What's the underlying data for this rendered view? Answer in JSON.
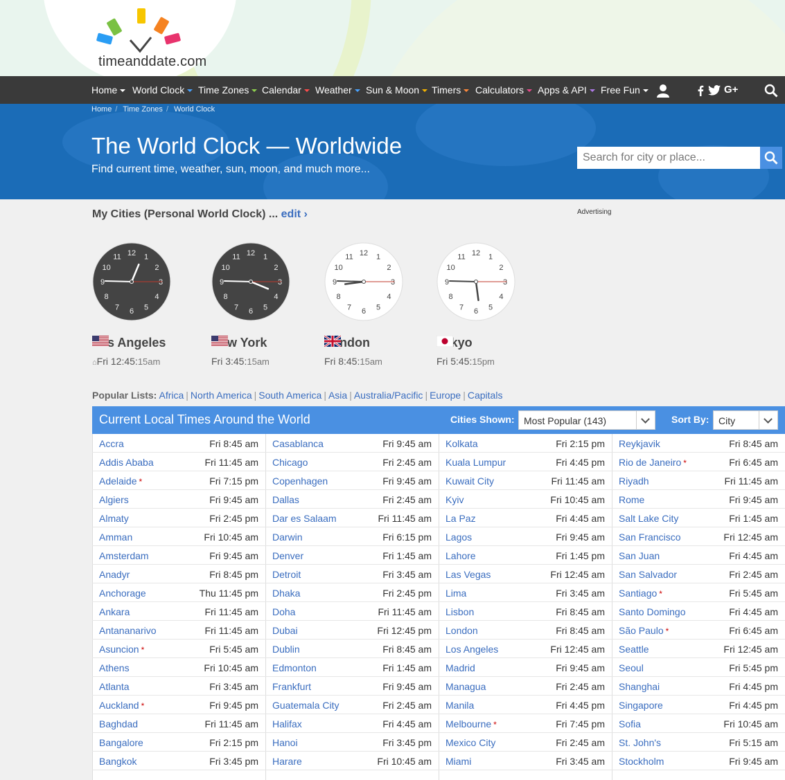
{
  "logo": {
    "text": "timeanddate.com"
  },
  "colors": {
    "nav_bg": "#3a3a3a",
    "banner_bg": "#1b6cb7",
    "table_header": "#4a90e2",
    "link": "#3a6dbf"
  },
  "nav": {
    "items": [
      {
        "label": "Home",
        "caret": "#ffffff"
      },
      {
        "label": "World Clock",
        "caret": "#4aa3ff"
      },
      {
        "label": "Time Zones",
        "caret": "#8fd14f"
      },
      {
        "label": "Calendar",
        "caret": "#ff4d4d"
      },
      {
        "label": "Weather",
        "caret": "#4aa3ff"
      },
      {
        "label": "Sun & Moon",
        "caret": "#f5b400"
      },
      {
        "label": "Timers",
        "caret": "#ff8a3d"
      },
      {
        "label": "Calculators",
        "caret": "#e84a8a"
      },
      {
        "label": "Apps & API",
        "caret": "#b07be8"
      },
      {
        "label": "Free Fun",
        "caret": "#ffffff"
      }
    ],
    "icons": [
      "user-icon",
      "facebook-icon",
      "twitter-icon",
      "google-plus-icon",
      "search-icon"
    ]
  },
  "breadcrumb": [
    "Home",
    "Time Zones",
    "World Clock"
  ],
  "header": {
    "title": "The World Clock — Worldwide",
    "subtitle": "Find current time, weather, sun, moon, and much more...",
    "search_placeholder": "Search for city or place..."
  },
  "my_cities": {
    "title": "My Cities (Personal World Clock) ...",
    "edit": "edit ›",
    "advertising": "Advertising",
    "clocks": [
      {
        "city": "Los Angeles",
        "day": "Fri",
        "hm": "12:45:",
        "sec": "15",
        "ampm": "am",
        "home": true,
        "dark": true,
        "flag": "us",
        "hour": 0,
        "minute": 45,
        "second": 15
      },
      {
        "city": "New York",
        "day": "Fri",
        "hm": "3:45:",
        "sec": "15",
        "ampm": "am",
        "home": false,
        "dark": true,
        "flag": "us",
        "hour": 3,
        "minute": 45,
        "second": 15
      },
      {
        "city": "London",
        "day": "Fri",
        "hm": "8:45:",
        "sec": "15",
        "ampm": "am",
        "home": false,
        "dark": false,
        "flag": "uk",
        "hour": 8,
        "minute": 45,
        "second": 15
      },
      {
        "city": "Tokyo",
        "day": "Fri",
        "hm": "5:45:",
        "sec": "15",
        "ampm": "pm",
        "home": false,
        "dark": false,
        "flag": "jp",
        "hour": 17,
        "minute": 45,
        "second": 15
      }
    ]
  },
  "popular_lists": {
    "label": "Popular Lists:",
    "links": [
      "Africa",
      "North America",
      "South America",
      "Asia",
      "Australia/Pacific",
      "Europe",
      "Capitals"
    ]
  },
  "table": {
    "title": "Current Local Times Around the World",
    "cities_shown_label": "Cities Shown:",
    "cities_shown_value": "Most Popular (143)",
    "sort_by_label": "Sort By:",
    "sort_by_value": "City",
    "columns": [
      [
        {
          "city": "Accra",
          "time": "Fri 8:45 am"
        },
        {
          "city": "Addis Ababa",
          "time": "Fri 11:45 am"
        },
        {
          "city": "Adelaide",
          "time": "Fri 7:15 pm",
          "dst": true
        },
        {
          "city": "Algiers",
          "time": "Fri 9:45 am"
        },
        {
          "city": "Almaty",
          "time": "Fri 2:45 pm"
        },
        {
          "city": "Amman",
          "time": "Fri 10:45 am"
        },
        {
          "city": "Amsterdam",
          "time": "Fri 9:45 am"
        },
        {
          "city": "Anadyr",
          "time": "Fri 8:45 pm"
        },
        {
          "city": "Anchorage",
          "time": "Thu 11:45 pm"
        },
        {
          "city": "Ankara",
          "time": "Fri 11:45 am"
        },
        {
          "city": "Antananarivo",
          "time": "Fri 11:45 am"
        },
        {
          "city": "Asuncion",
          "time": "Fri 5:45 am",
          "dst": true
        },
        {
          "city": "Athens",
          "time": "Fri 10:45 am"
        },
        {
          "city": "Atlanta",
          "time": "Fri 3:45 am"
        },
        {
          "city": "Auckland",
          "time": "Fri 9:45 pm",
          "dst": true
        },
        {
          "city": "Baghdad",
          "time": "Fri 11:45 am"
        },
        {
          "city": "Bangalore",
          "time": "Fri 2:15 pm"
        },
        {
          "city": "Bangkok",
          "time": "Fri 3:45 pm"
        }
      ],
      [
        {
          "city": "Casablanca",
          "time": "Fri 9:45 am"
        },
        {
          "city": "Chicago",
          "time": "Fri 2:45 am"
        },
        {
          "city": "Copenhagen",
          "time": "Fri 9:45 am"
        },
        {
          "city": "Dallas",
          "time": "Fri 2:45 am"
        },
        {
          "city": "Dar es Salaam",
          "time": "Fri 11:45 am"
        },
        {
          "city": "Darwin",
          "time": "Fri 6:15 pm"
        },
        {
          "city": "Denver",
          "time": "Fri 1:45 am"
        },
        {
          "city": "Detroit",
          "time": "Fri 3:45 am"
        },
        {
          "city": "Dhaka",
          "time": "Fri 2:45 pm"
        },
        {
          "city": "Doha",
          "time": "Fri 11:45 am"
        },
        {
          "city": "Dubai",
          "time": "Fri 12:45 pm"
        },
        {
          "city": "Dublin",
          "time": "Fri 8:45 am"
        },
        {
          "city": "Edmonton",
          "time": "Fri 1:45 am"
        },
        {
          "city": "Frankfurt",
          "time": "Fri 9:45 am"
        },
        {
          "city": "Guatemala City",
          "time": "Fri 2:45 am"
        },
        {
          "city": "Halifax",
          "time": "Fri 4:45 am"
        },
        {
          "city": "Hanoi",
          "time": "Fri 3:45 pm"
        },
        {
          "city": "Harare",
          "time": "Fri 10:45 am"
        }
      ],
      [
        {
          "city": "Kolkata",
          "time": "Fri 2:15 pm"
        },
        {
          "city": "Kuala Lumpur",
          "time": "Fri 4:45 pm"
        },
        {
          "city": "Kuwait City",
          "time": "Fri 11:45 am"
        },
        {
          "city": "Kyiv",
          "time": "Fri 10:45 am"
        },
        {
          "city": "La Paz",
          "time": "Fri 4:45 am"
        },
        {
          "city": "Lagos",
          "time": "Fri 9:45 am"
        },
        {
          "city": "Lahore",
          "time": "Fri 1:45 pm"
        },
        {
          "city": "Las Vegas",
          "time": "Fri 12:45 am"
        },
        {
          "city": "Lima",
          "time": "Fri 3:45 am"
        },
        {
          "city": "Lisbon",
          "time": "Fri 8:45 am"
        },
        {
          "city": "London",
          "time": "Fri 8:45 am"
        },
        {
          "city": "Los Angeles",
          "time": "Fri 12:45 am"
        },
        {
          "city": "Madrid",
          "time": "Fri 9:45 am"
        },
        {
          "city": "Managua",
          "time": "Fri 2:45 am"
        },
        {
          "city": "Manila",
          "time": "Fri 4:45 pm"
        },
        {
          "city": "Melbourne",
          "time": "Fri 7:45 pm",
          "dst": true
        },
        {
          "city": "Mexico City",
          "time": "Fri 2:45 am"
        },
        {
          "city": "Miami",
          "time": "Fri 3:45 am"
        }
      ],
      [
        {
          "city": "Reykjavik",
          "time": "Fri 8:45 am"
        },
        {
          "city": "Rio de Janeiro",
          "time": "Fri 6:45 am",
          "dst": true
        },
        {
          "city": "Riyadh",
          "time": "Fri 11:45 am"
        },
        {
          "city": "Rome",
          "time": "Fri 9:45 am"
        },
        {
          "city": "Salt Lake City",
          "time": "Fri 1:45 am"
        },
        {
          "city": "San Francisco",
          "time": "Fri 12:45 am"
        },
        {
          "city": "San Juan",
          "time": "Fri 4:45 am"
        },
        {
          "city": "San Salvador",
          "time": "Fri 2:45 am"
        },
        {
          "city": "Santiago",
          "time": "Fri 5:45 am",
          "dst": true
        },
        {
          "city": "Santo Domingo",
          "time": "Fri 4:45 am"
        },
        {
          "city": "São Paulo",
          "time": "Fri 6:45 am",
          "dst": true
        },
        {
          "city": "Seattle",
          "time": "Fri 12:45 am"
        },
        {
          "city": "Seoul",
          "time": "Fri 5:45 pm"
        },
        {
          "city": "Shanghai",
          "time": "Fri 4:45 pm"
        },
        {
          "city": "Singapore",
          "time": "Fri 4:45 pm"
        },
        {
          "city": "Sofia",
          "time": "Fri 10:45 am"
        },
        {
          "city": "St. John's",
          "time": "Fri 5:15 am"
        },
        {
          "city": "Stockholm",
          "time": "Fri 9:45 am"
        }
      ]
    ]
  }
}
